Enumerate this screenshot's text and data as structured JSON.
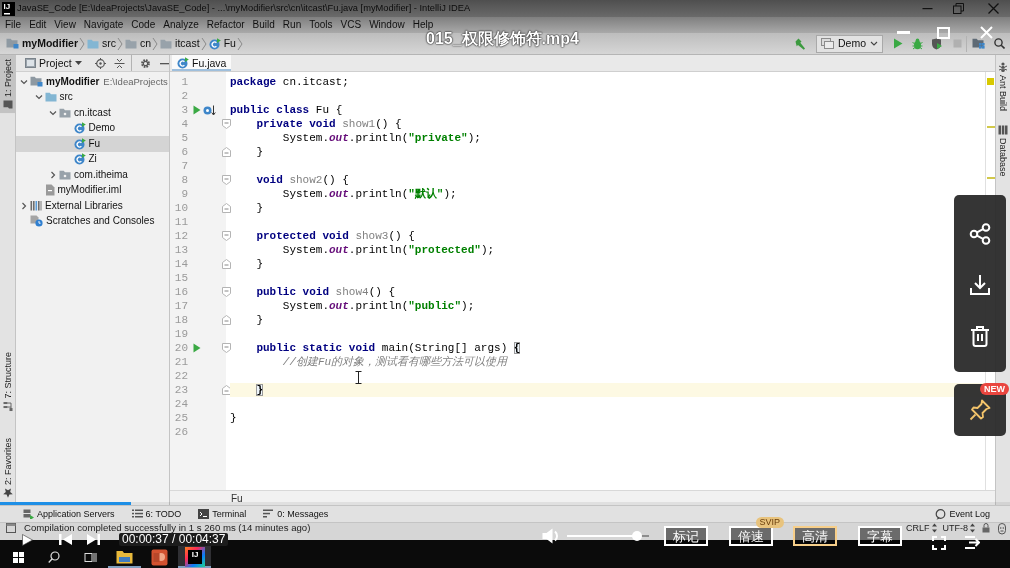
{
  "ide_window": {
    "logo_text": "IJ",
    "title": "JavaSE_Code [E:\\IdeaProjects\\JavaSE_Code] - ...\\myModifier\\src\\cn\\itcast\\Fu.java [myModifier] - IntelliJ IDEA"
  },
  "menu": [
    "File",
    "Edit",
    "View",
    "Navigate",
    "Code",
    "Analyze",
    "Refactor",
    "Build",
    "Run",
    "Tools",
    "VCS",
    "Window",
    "Help"
  ],
  "navigation_bar": {
    "breadcrumbs": [
      {
        "label": "myModifier",
        "kind": "module"
      },
      {
        "label": "src",
        "kind": "source-folder"
      },
      {
        "label": "cn",
        "kind": "folder"
      },
      {
        "label": "itcast",
        "kind": "folder"
      },
      {
        "label": "Fu",
        "kind": "class"
      }
    ],
    "run_configuration": "Demo"
  },
  "left_tool_tabs": [
    {
      "label": "1: Project",
      "kind": "project",
      "selected": true
    },
    {
      "label": "7: Structure",
      "kind": "structure",
      "selected": false
    },
    {
      "label": "2: Favorites",
      "kind": "favorites",
      "selected": false
    }
  ],
  "project_panel": {
    "view": "Project",
    "tree": [
      {
        "label": "myModifier",
        "path": "E:\\IdeaProjects",
        "kind": "module",
        "expanded": true,
        "selected": false,
        "children": [
          {
            "label": "src",
            "kind": "source-folder",
            "expanded": true,
            "selected": false,
            "children": [
              {
                "label": "cn.itcast",
                "kind": "package",
                "expanded": true,
                "selected": false,
                "children": [
                  {
                    "label": "Demo",
                    "kind": "class",
                    "selected": false
                  },
                  {
                    "label": "Fu",
                    "kind": "class",
                    "selected": true
                  },
                  {
                    "label": "Zi",
                    "kind": "class",
                    "selected": false
                  }
                ]
              },
              {
                "label": "com.itheima",
                "kind": "package",
                "expanded": false,
                "selected": false
              }
            ]
          },
          {
            "label": "myModifier.iml",
            "kind": "iml",
            "selected": false
          }
        ]
      },
      {
        "label": "External Libraries",
        "kind": "libraries",
        "expanded": false,
        "selected": false
      },
      {
        "label": "Scratches and Consoles",
        "kind": "scratches",
        "selected": false
      }
    ]
  },
  "editor": {
    "tabs": [
      {
        "label": "Fu.java",
        "selected": true
      }
    ],
    "lines": [
      {
        "number": "1",
        "current": false,
        "tokens": [
          {
            "kind": "keyword",
            "text": "package "
          },
          {
            "kind": "plain",
            "text": "cn.itcast;"
          }
        ]
      },
      {
        "number": "2",
        "current": false
      },
      {
        "number": "3",
        "current": false,
        "gutter_icons": [
          {
            "kind": "run"
          },
          {
            "kind": "subclassed"
          }
        ],
        "tokens": [
          {
            "kind": "keyword",
            "text": "public class "
          },
          {
            "kind": "plain",
            "text": "Fu {"
          }
        ]
      },
      {
        "number": "4",
        "current": false,
        "fold_marker": {
          "kind": "start"
        },
        "tokens": [
          {
            "kind": "keyword",
            "text": "    private void "
          },
          {
            "kind": "unused",
            "text": "show1"
          },
          {
            "kind": "plain",
            "text": "() {"
          }
        ]
      },
      {
        "number": "5",
        "current": false,
        "tokens": [
          {
            "kind": "plain",
            "text": "        System."
          },
          {
            "kind": "static_field",
            "text": "out"
          },
          {
            "kind": "plain",
            "text": ".println("
          },
          {
            "kind": "string",
            "text": "\"private\""
          },
          {
            "kind": "plain",
            "text": ");"
          }
        ]
      },
      {
        "number": "6",
        "current": false,
        "fold_marker": {
          "kind": "end"
        },
        "tokens": [
          {
            "kind": "plain",
            "text": "    }"
          }
        ]
      },
      {
        "number": "7",
        "current": false
      },
      {
        "number": "8",
        "current": false,
        "fold_marker": {
          "kind": "start"
        },
        "tokens": [
          {
            "kind": "keyword",
            "text": "    void "
          },
          {
            "kind": "unused",
            "text": "show2"
          },
          {
            "kind": "plain",
            "text": "() {"
          }
        ]
      },
      {
        "number": "9",
        "current": false,
        "tokens": [
          {
            "kind": "plain",
            "text": "        System."
          },
          {
            "kind": "static_field",
            "text": "out"
          },
          {
            "kind": "plain",
            "text": ".println("
          },
          {
            "kind": "string",
            "text": "\"默认\""
          },
          {
            "kind": "plain",
            "text": ");"
          }
        ]
      },
      {
        "number": "10",
        "current": false,
        "fold_marker": {
          "kind": "end"
        },
        "tokens": [
          {
            "kind": "plain",
            "text": "    }"
          }
        ]
      },
      {
        "number": "11",
        "current": false
      },
      {
        "number": "12",
        "current": false,
        "fold_marker": {
          "kind": "start"
        },
        "tokens": [
          {
            "kind": "keyword",
            "text": "    protected void "
          },
          {
            "kind": "unused",
            "text": "show3"
          },
          {
            "kind": "plain",
            "text": "() {"
          }
        ]
      },
      {
        "number": "13",
        "current": false,
        "tokens": [
          {
            "kind": "plain",
            "text": "        System."
          },
          {
            "kind": "static_field",
            "text": "out"
          },
          {
            "kind": "plain",
            "text": ".println("
          },
          {
            "kind": "string",
            "text": "\"protected\""
          },
          {
            "kind": "plain",
            "text": ");"
          }
        ]
      },
      {
        "number": "14",
        "current": false,
        "fold_marker": {
          "kind": "end"
        },
        "tokens": [
          {
            "kind": "plain",
            "text": "    }"
          }
        ]
      },
      {
        "number": "15",
        "current": false
      },
      {
        "number": "16",
        "current": false,
        "fold_marker": {
          "kind": "start"
        },
        "tokens": [
          {
            "kind": "keyword",
            "text": "    public void "
          },
          {
            "kind": "unused",
            "text": "show4"
          },
          {
            "kind": "plain",
            "text": "() {"
          }
        ]
      },
      {
        "number": "17",
        "current": false,
        "tokens": [
          {
            "kind": "plain",
            "text": "        System."
          },
          {
            "kind": "static_field",
            "text": "out"
          },
          {
            "kind": "plain",
            "text": ".println("
          },
          {
            "kind": "string",
            "text": "\"public\""
          },
          {
            "kind": "plain",
            "text": ");"
          }
        ]
      },
      {
        "number": "18",
        "current": false,
        "fold_marker": {
          "kind": "end"
        },
        "tokens": [
          {
            "kind": "plain",
            "text": "    }"
          }
        ]
      },
      {
        "number": "19",
        "current": false
      },
      {
        "number": "20",
        "current": false,
        "gutter_icons": [
          {
            "kind": "run"
          }
        ],
        "fold_marker": {
          "kind": "start"
        },
        "tokens": [
          {
            "kind": "keyword",
            "text": "    public static void "
          },
          {
            "kind": "plain",
            "text": "main(String[] args) "
          },
          {
            "kind": "brace_match",
            "text": "{"
          }
        ]
      },
      {
        "number": "21",
        "current": false,
        "tokens": [
          {
            "kind": "comment",
            "text": "        //创建Fu的对象，测试看有哪些方法可以使用"
          }
        ]
      },
      {
        "number": "22",
        "current": false
      },
      {
        "number": "23",
        "current": true,
        "fold_marker": {
          "kind": "end"
        },
        "tokens": [
          {
            "kind": "brace_match",
            "text": "    }"
          }
        ]
      },
      {
        "number": "24",
        "current": false
      },
      {
        "number": "25",
        "current": false,
        "tokens": [
          {
            "kind": "plain",
            "text": "}"
          }
        ]
      },
      {
        "number": "26",
        "current": false
      }
    ],
    "breadcrumb": "Fu"
  },
  "right_tool_tabs": [
    {
      "label": "Ant Build",
      "kind": "ant"
    },
    {
      "label": "Database",
      "kind": "database"
    }
  ],
  "tool_window_bar": {
    "left": [
      {
        "label": "Application Servers",
        "kind": "servers"
      },
      {
        "label": "6: TODO",
        "kind": "todo"
      },
      {
        "label": "Terminal",
        "kind": "terminal"
      },
      {
        "label": "0: Messages",
        "kind": "messages"
      }
    ],
    "right": [
      {
        "label": "Event Log",
        "kind": "event-log"
      }
    ]
  },
  "status_bar": {
    "message": "Compilation completed successfully in 1 s 260 ms (14 minutes ago)",
    "line_separator": "CRLF",
    "encoding": "UTF-8"
  },
  "video_player": {
    "title": "015_权限修饰符.mp4",
    "progress": {
      "level": 0.13
    },
    "time": "00:00:37 / 00:04:37",
    "volume": {
      "level": 0.85
    },
    "buttons": [
      {
        "label": "标记",
        "selected": false
      },
      {
        "label": "倍速",
        "selected": false,
        "badge": "SVIP"
      },
      {
        "label": "高清",
        "selected": true
      },
      {
        "label": "字幕",
        "selected": false
      }
    ],
    "pin_badge": "NEW"
  },
  "taskbar": {
    "apps": [
      {
        "kind": "explorer",
        "running": true,
        "active": false
      },
      {
        "kind": "presentation",
        "running": false,
        "active": false
      },
      {
        "kind": "ide",
        "running": true,
        "active": true,
        "label": "IJ"
      }
    ]
  }
}
